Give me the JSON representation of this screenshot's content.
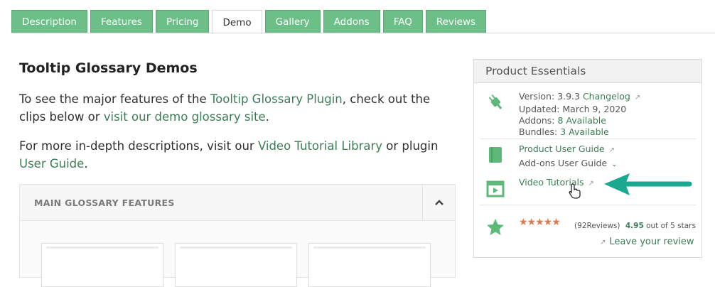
{
  "tabs": [
    "Description",
    "Features",
    "Pricing",
    "Demo",
    "Gallery",
    "Addons",
    "FAQ",
    "Reviews"
  ],
  "active_tab": "Demo",
  "main": {
    "title": "Tooltip Glossary Demos",
    "p1_a": "To see the major features of the ",
    "p1_link1": "Tooltip Glossary Plugin",
    "p1_b": ", check out the clips below or ",
    "p1_link2": "visit our demo glossary site",
    "p1_c": ".",
    "p2_a": "For more in-depth descriptions, visit our ",
    "p2_link1": "Video Tutorial Library",
    "p2_b": " or plugin ",
    "p2_link2": "User Guide",
    "p2_c": ".",
    "accordion_title": "MAIN GLOSSARY FEATURES"
  },
  "sidebar": {
    "title": "Product Essentials",
    "version_label": "Version: 3.9.3 ",
    "changelog": "Changelog",
    "updated": "Updated: March 9, 2020",
    "addons_label": "Addons: ",
    "addons_value": "8 Available",
    "bundles_label": "Bundles: ",
    "bundles_value": "3 Available",
    "user_guide": "Product User Guide",
    "addons_guide": "Add-ons User Guide",
    "video_tutorials": "Video Tutorials",
    "reviews_count": "(92Reviews)",
    "score": "4.95",
    "score_suffix": " out of 5 stars",
    "leave_review": "Leave your review",
    "stars": "★★★★★",
    "rating_fraction": 0.95
  },
  "colors": {
    "brand_green": "#6bbf87",
    "link_green": "#3d7d55",
    "star_orange": "#e07a4a",
    "arrow_teal": "#1aa890"
  }
}
